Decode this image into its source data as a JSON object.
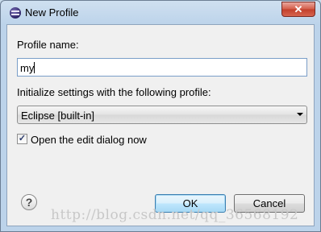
{
  "window": {
    "title": "New Profile",
    "close_label": "✕"
  },
  "form": {
    "profile_name_label": "Profile name:",
    "profile_name_value": "my",
    "init_label": "Initialize settings with the following profile:",
    "profile_select_value": "Eclipse [built-in]",
    "open_edit_label": "Open the edit dialog now",
    "open_edit_checked": true
  },
  "buttons": {
    "help_label": "?",
    "ok_label": "OK",
    "cancel_label": "Cancel"
  },
  "watermark": "http://blog.csdn.net/qq_36568192",
  "colors": {
    "title_bar": "#bcd3ea",
    "close_button": "#c23f2b",
    "client_background": "#f0f0f0"
  }
}
